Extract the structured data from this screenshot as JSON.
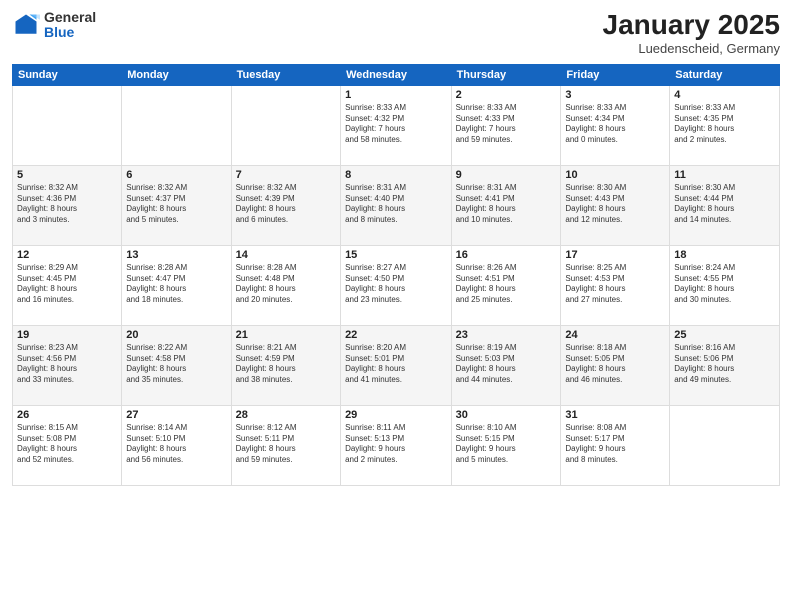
{
  "header": {
    "logo_general": "General",
    "logo_blue": "Blue",
    "month_title": "January 2025",
    "location": "Luedenscheid, Germany"
  },
  "days_of_week": [
    "Sunday",
    "Monday",
    "Tuesday",
    "Wednesday",
    "Thursday",
    "Friday",
    "Saturday"
  ],
  "weeks": [
    [
      {
        "day": "",
        "info": ""
      },
      {
        "day": "",
        "info": ""
      },
      {
        "day": "",
        "info": ""
      },
      {
        "day": "1",
        "info": "Sunrise: 8:33 AM\nSunset: 4:32 PM\nDaylight: 7 hours\nand 58 minutes."
      },
      {
        "day": "2",
        "info": "Sunrise: 8:33 AM\nSunset: 4:33 PM\nDaylight: 7 hours\nand 59 minutes."
      },
      {
        "day": "3",
        "info": "Sunrise: 8:33 AM\nSunset: 4:34 PM\nDaylight: 8 hours\nand 0 minutes."
      },
      {
        "day": "4",
        "info": "Sunrise: 8:33 AM\nSunset: 4:35 PM\nDaylight: 8 hours\nand 2 minutes."
      }
    ],
    [
      {
        "day": "5",
        "info": "Sunrise: 8:32 AM\nSunset: 4:36 PM\nDaylight: 8 hours\nand 3 minutes."
      },
      {
        "day": "6",
        "info": "Sunrise: 8:32 AM\nSunset: 4:37 PM\nDaylight: 8 hours\nand 5 minutes."
      },
      {
        "day": "7",
        "info": "Sunrise: 8:32 AM\nSunset: 4:39 PM\nDaylight: 8 hours\nand 6 minutes."
      },
      {
        "day": "8",
        "info": "Sunrise: 8:31 AM\nSunset: 4:40 PM\nDaylight: 8 hours\nand 8 minutes."
      },
      {
        "day": "9",
        "info": "Sunrise: 8:31 AM\nSunset: 4:41 PM\nDaylight: 8 hours\nand 10 minutes."
      },
      {
        "day": "10",
        "info": "Sunrise: 8:30 AM\nSunset: 4:43 PM\nDaylight: 8 hours\nand 12 minutes."
      },
      {
        "day": "11",
        "info": "Sunrise: 8:30 AM\nSunset: 4:44 PM\nDaylight: 8 hours\nand 14 minutes."
      }
    ],
    [
      {
        "day": "12",
        "info": "Sunrise: 8:29 AM\nSunset: 4:45 PM\nDaylight: 8 hours\nand 16 minutes."
      },
      {
        "day": "13",
        "info": "Sunrise: 8:28 AM\nSunset: 4:47 PM\nDaylight: 8 hours\nand 18 minutes."
      },
      {
        "day": "14",
        "info": "Sunrise: 8:28 AM\nSunset: 4:48 PM\nDaylight: 8 hours\nand 20 minutes."
      },
      {
        "day": "15",
        "info": "Sunrise: 8:27 AM\nSunset: 4:50 PM\nDaylight: 8 hours\nand 23 minutes."
      },
      {
        "day": "16",
        "info": "Sunrise: 8:26 AM\nSunset: 4:51 PM\nDaylight: 8 hours\nand 25 minutes."
      },
      {
        "day": "17",
        "info": "Sunrise: 8:25 AM\nSunset: 4:53 PM\nDaylight: 8 hours\nand 27 minutes."
      },
      {
        "day": "18",
        "info": "Sunrise: 8:24 AM\nSunset: 4:55 PM\nDaylight: 8 hours\nand 30 minutes."
      }
    ],
    [
      {
        "day": "19",
        "info": "Sunrise: 8:23 AM\nSunset: 4:56 PM\nDaylight: 8 hours\nand 33 minutes."
      },
      {
        "day": "20",
        "info": "Sunrise: 8:22 AM\nSunset: 4:58 PM\nDaylight: 8 hours\nand 35 minutes."
      },
      {
        "day": "21",
        "info": "Sunrise: 8:21 AM\nSunset: 4:59 PM\nDaylight: 8 hours\nand 38 minutes."
      },
      {
        "day": "22",
        "info": "Sunrise: 8:20 AM\nSunset: 5:01 PM\nDaylight: 8 hours\nand 41 minutes."
      },
      {
        "day": "23",
        "info": "Sunrise: 8:19 AM\nSunset: 5:03 PM\nDaylight: 8 hours\nand 44 minutes."
      },
      {
        "day": "24",
        "info": "Sunrise: 8:18 AM\nSunset: 5:05 PM\nDaylight: 8 hours\nand 46 minutes."
      },
      {
        "day": "25",
        "info": "Sunrise: 8:16 AM\nSunset: 5:06 PM\nDaylight: 8 hours\nand 49 minutes."
      }
    ],
    [
      {
        "day": "26",
        "info": "Sunrise: 8:15 AM\nSunset: 5:08 PM\nDaylight: 8 hours\nand 52 minutes."
      },
      {
        "day": "27",
        "info": "Sunrise: 8:14 AM\nSunset: 5:10 PM\nDaylight: 8 hours\nand 56 minutes."
      },
      {
        "day": "28",
        "info": "Sunrise: 8:12 AM\nSunset: 5:11 PM\nDaylight: 8 hours\nand 59 minutes."
      },
      {
        "day": "29",
        "info": "Sunrise: 8:11 AM\nSunset: 5:13 PM\nDaylight: 9 hours\nand 2 minutes."
      },
      {
        "day": "30",
        "info": "Sunrise: 8:10 AM\nSunset: 5:15 PM\nDaylight: 9 hours\nand 5 minutes."
      },
      {
        "day": "31",
        "info": "Sunrise: 8:08 AM\nSunset: 5:17 PM\nDaylight: 9 hours\nand 8 minutes."
      },
      {
        "day": "",
        "info": ""
      }
    ]
  ]
}
